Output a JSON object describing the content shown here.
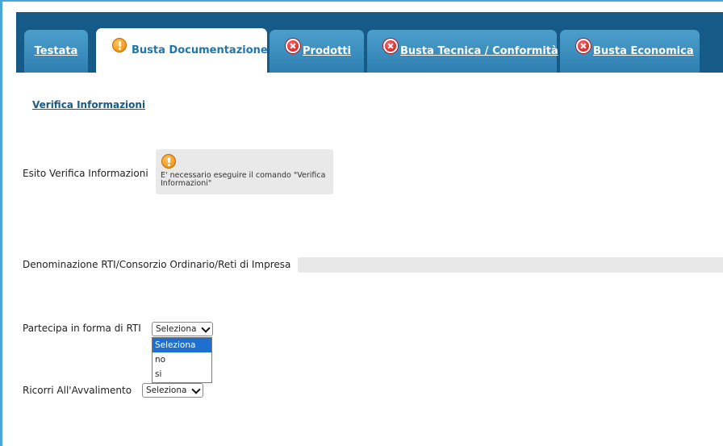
{
  "tabs": [
    {
      "label": "Testata",
      "icon": "none",
      "active": false
    },
    {
      "label": "Busta Documentazione",
      "icon": "warning-icon",
      "active": true
    },
    {
      "label": "Prodotti",
      "icon": "error-icon",
      "active": false
    },
    {
      "label": "Busta Tecnica / Conformità",
      "icon": "error-icon",
      "active": false
    },
    {
      "label": "Busta Economica",
      "icon": "error-icon",
      "active": false
    }
  ],
  "verifica_link": "Verifica Informazioni",
  "esito": {
    "label": "Esito Verifica Informazioni",
    "message": "E' necessario eseguire il comando \"Verifica Informazioni\""
  },
  "denominazione": {
    "label": "Denominazione RTI/Consorzio Ordinario/Reti di Impresa",
    "value": ""
  },
  "partecipa": {
    "label": "Partecipa in forma di RTI",
    "selected": "Seleziona",
    "options": [
      "Seleziona",
      "no",
      "si"
    ]
  },
  "ricorri": {
    "label": "Ricorri All'Avvalimento",
    "selected": "Seleziona"
  },
  "colors": {
    "tab_bar": "#165a88",
    "tab": "#3b8fc1",
    "active_text": "#1d76ae",
    "frame_border": "#4aa6d8",
    "option_selected": "#1f6fd0"
  }
}
